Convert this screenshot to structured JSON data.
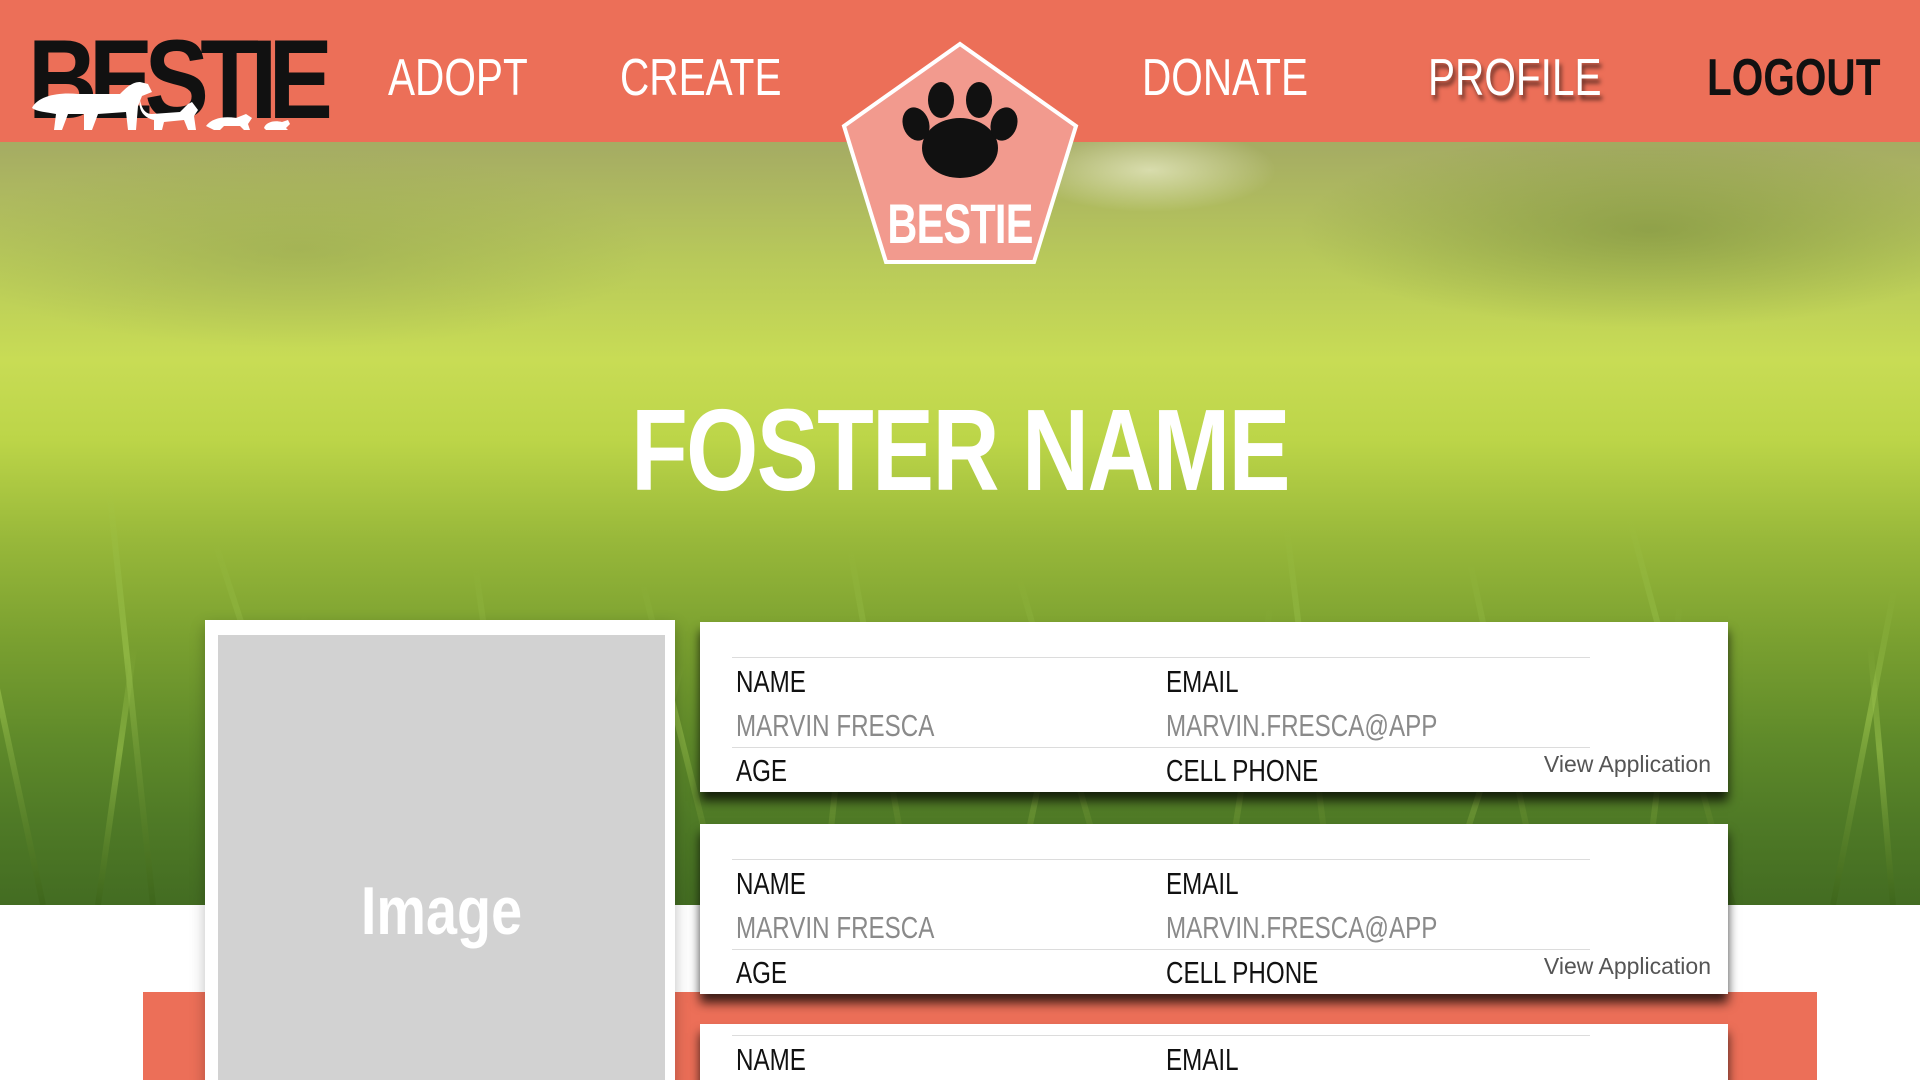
{
  "brand": {
    "logo_text": "BESTIE",
    "badge_text": "BESTIE"
  },
  "nav": {
    "adopt": "ADOPT",
    "create": "CREATE",
    "donate": "DONATE",
    "profile": "PROFILE",
    "logout": "LOGOUT"
  },
  "page": {
    "title": "FOSTER NAME",
    "image_placeholder": "Image"
  },
  "applications": [
    {
      "name_label": "NAME",
      "name_value": "MARVIN FRESCA",
      "email_label": "EMAIL",
      "email_value": "MARVIN.FRESCA@APP",
      "age_label": "AGE",
      "phone_label": "CELL PHONE",
      "action_label": "View Application"
    },
    {
      "name_label": "NAME",
      "name_value": "MARVIN FRESCA",
      "email_label": "EMAIL",
      "email_value": "MARVIN.FRESCA@APP",
      "age_label": "AGE",
      "phone_label": "CELL PHONE",
      "action_label": "View Application"
    },
    {
      "name_label": "NAME",
      "email_label": "EMAIL"
    }
  ],
  "colors": {
    "accent": "#ec6f58",
    "badge_fill": "#f29a8e",
    "image_placeholder": "#d2d2d2"
  },
  "icons": {
    "badge": "paw-icon",
    "logo": "animals-silhouette-icon"
  }
}
